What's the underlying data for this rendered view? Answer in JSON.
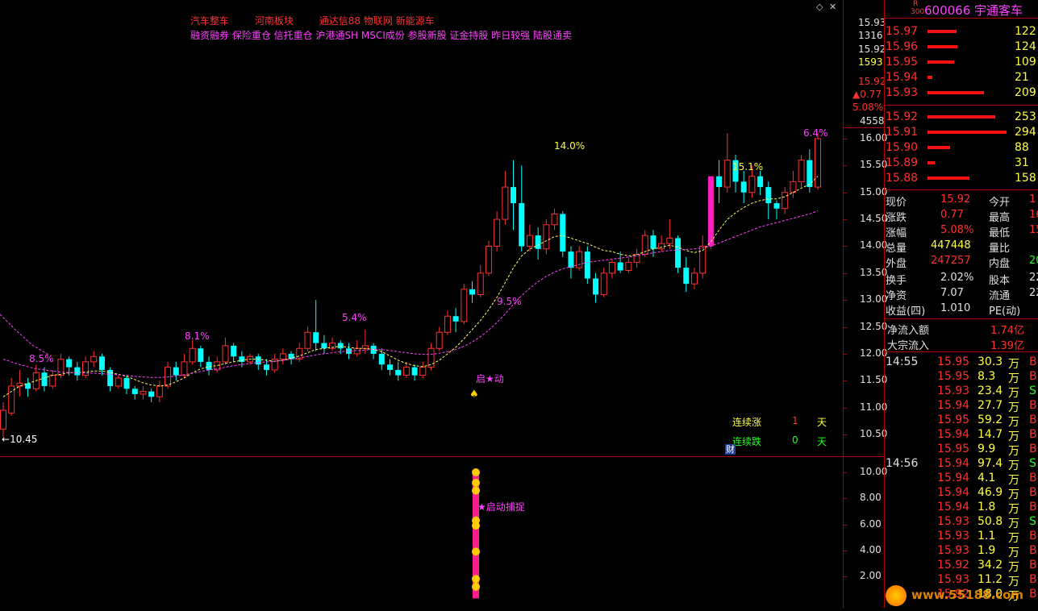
{
  "header": {
    "tags_line1": [
      "汽车整车",
      "河南板块",
      "通达信88 物联网 新能源车"
    ],
    "tags_line2": "融资融券 保险重仓 信托重仓 沪港通SH MSCI成份 参股新股 证金持股 昨日较强 陆股通卖"
  },
  "stock": {
    "badge_top": "R",
    "badge_bottom": "300",
    "code_name": "600066 宇通客车"
  },
  "main_axis": {
    "labels": [
      "16.00",
      "15.50",
      "15.00",
      "14.50",
      "14.00",
      "13.50",
      "13.00",
      "12.50",
      "12.00",
      "11.50",
      "11.00",
      "10.50"
    ],
    "top_info": [
      "15.93",
      "1316",
      "15.92",
      "1593",
      "15.92",
      "▲0.77",
      "5.08%",
      "4558"
    ]
  },
  "sub_axis": {
    "labels": [
      "10.00",
      "8.00",
      "6.00",
      "4.00",
      "2.00"
    ]
  },
  "chart_annotations": {
    "pct_labels": [
      "8.5%",
      "8.1%",
      "5.4%",
      "9.5%",
      "14.0%",
      "15.1%",
      "6.4%"
    ],
    "low_label": "10.45",
    "start_label": "启★动",
    "start_capture": "启动捕捉",
    "consec_up_label": "连续涨",
    "consec_up_count": "1",
    "consec_down_label": "连续跌",
    "consec_down_count": "0",
    "day_unit": "天",
    "cai_badge": "财"
  },
  "chart_data": {
    "type": "candlestick",
    "ylim": [
      10.2,
      16.3
    ],
    "candles": [
      [
        10.6,
        10.95,
        10.45,
        11.1
      ],
      [
        10.9,
        11.4,
        10.85,
        11.55
      ],
      [
        11.4,
        11.45,
        11.2,
        11.7
      ],
      [
        11.45,
        11.35,
        11.2,
        11.55
      ],
      [
        11.35,
        11.65,
        11.3,
        11.8
      ],
      [
        11.65,
        11.4,
        11.3,
        11.75
      ],
      [
        11.4,
        11.6,
        11.35,
        11.7
      ],
      [
        11.6,
        11.9,
        11.55,
        12.0
      ],
      [
        11.9,
        11.75,
        11.6,
        11.95
      ],
      [
        11.75,
        11.6,
        11.5,
        11.85
      ],
      [
        11.6,
        11.85,
        11.55,
        11.95
      ],
      [
        11.85,
        11.95,
        11.75,
        12.05
      ],
      [
        11.95,
        11.7,
        11.6,
        12.0
      ],
      [
        11.7,
        11.4,
        11.3,
        11.75
      ],
      [
        11.4,
        11.55,
        11.35,
        11.6
      ],
      [
        11.55,
        11.35,
        11.25,
        11.6
      ],
      [
        11.35,
        11.25,
        11.15,
        11.4
      ],
      [
        11.25,
        11.3,
        11.15,
        11.4
      ],
      [
        11.3,
        11.2,
        11.1,
        11.35
      ],
      [
        11.2,
        11.4,
        11.1,
        11.5
      ],
      [
        11.4,
        11.75,
        11.35,
        11.85
      ],
      [
        11.75,
        11.6,
        11.5,
        11.85
      ],
      [
        11.6,
        11.85,
        11.55,
        12.0
      ],
      [
        11.85,
        12.1,
        11.8,
        12.25
      ],
      [
        12.1,
        11.85,
        11.75,
        12.15
      ],
      [
        11.85,
        11.7,
        11.6,
        11.95
      ],
      [
        11.7,
        11.85,
        11.65,
        11.95
      ],
      [
        11.85,
        12.15,
        11.8,
        12.3
      ],
      [
        12.15,
        11.95,
        11.85,
        12.2
      ],
      [
        11.95,
        11.85,
        11.75,
        12.05
      ],
      [
        11.85,
        11.95,
        11.8,
        12.0
      ],
      [
        11.95,
        11.8,
        11.7,
        12.0
      ],
      [
        11.8,
        11.7,
        11.6,
        11.9
      ],
      [
        11.7,
        11.9,
        11.65,
        12.0
      ],
      [
        11.9,
        12.0,
        11.8,
        12.1
      ],
      [
        12.0,
        11.9,
        11.8,
        12.05
      ],
      [
        11.9,
        12.1,
        11.85,
        12.2
      ],
      [
        12.1,
        12.4,
        12.05,
        12.5
      ],
      [
        12.4,
        12.2,
        12.05,
        13.0
      ],
      [
        12.2,
        12.1,
        12.0,
        12.35
      ],
      [
        12.1,
        12.2,
        12.05,
        12.3
      ],
      [
        12.2,
        12.1,
        12.0,
        12.25
      ],
      [
        12.1,
        12.0,
        11.9,
        12.2
      ],
      [
        12.0,
        12.1,
        11.95,
        12.25
      ],
      [
        12.1,
        12.15,
        12.0,
        12.45
      ],
      [
        12.15,
        12.0,
        11.9,
        12.2
      ],
      [
        12.0,
        11.8,
        11.7,
        12.1
      ],
      [
        11.8,
        11.7,
        11.6,
        11.9
      ],
      [
        11.7,
        11.6,
        11.5,
        11.85
      ],
      [
        11.6,
        11.75,
        11.55,
        11.85
      ],
      [
        11.75,
        11.6,
        11.5,
        11.8
      ],
      [
        11.6,
        11.75,
        11.55,
        11.85
      ],
      [
        11.75,
        12.1,
        11.7,
        12.2
      ],
      [
        12.1,
        12.4,
        12.05,
        12.5
      ],
      [
        12.4,
        12.7,
        12.35,
        12.8
      ],
      [
        12.7,
        12.6,
        12.4,
        12.85
      ],
      [
        12.6,
        13.2,
        12.55,
        13.3
      ],
      [
        13.2,
        13.1,
        12.95,
        13.35
      ],
      [
        13.1,
        13.5,
        13.05,
        13.65
      ],
      [
        13.5,
        14.0,
        13.45,
        14.1
      ],
      [
        14.0,
        14.5,
        13.9,
        14.65
      ],
      [
        14.5,
        15.1,
        14.4,
        15.4
      ],
      [
        15.1,
        14.8,
        14.3,
        15.6
      ],
      [
        14.8,
        14.0,
        13.9,
        15.5
      ],
      [
        14.0,
        14.2,
        13.9,
        14.4
      ],
      [
        14.2,
        13.95,
        13.75,
        14.35
      ],
      [
        13.95,
        14.4,
        13.85,
        14.5
      ],
      [
        14.4,
        14.6,
        14.3,
        14.7
      ],
      [
        14.6,
        13.9,
        13.8,
        14.65
      ],
      [
        13.9,
        13.6,
        13.4,
        14.0
      ],
      [
        13.6,
        13.9,
        13.55,
        14.0
      ],
      [
        13.9,
        13.4,
        13.3,
        14.0
      ],
      [
        13.4,
        13.1,
        12.95,
        13.5
      ],
      [
        13.1,
        13.5,
        13.05,
        13.6
      ],
      [
        13.5,
        13.7,
        13.4,
        13.75
      ],
      [
        13.7,
        13.55,
        13.5,
        13.9
      ],
      [
        13.55,
        13.7,
        13.5,
        13.8
      ],
      [
        13.7,
        13.85,
        13.6,
        13.95
      ],
      [
        13.85,
        14.2,
        13.8,
        14.3
      ],
      [
        14.2,
        13.95,
        13.8,
        14.3
      ],
      [
        13.95,
        14.05,
        13.9,
        14.2
      ],
      [
        14.05,
        14.15,
        13.95,
        14.5
      ],
      [
        14.15,
        13.6,
        13.5,
        14.2
      ],
      [
        13.6,
        13.3,
        13.15,
        13.8
      ],
      [
        13.3,
        13.5,
        13.2,
        13.6
      ],
      [
        13.5,
        14.0,
        13.4,
        14.2
      ],
      [
        14.0,
        15.3,
        13.95,
        15.3
      ],
      [
        15.3,
        15.1,
        14.8,
        15.6
      ],
      [
        15.1,
        15.6,
        15.0,
        16.1
      ],
      [
        15.6,
        15.2,
        15.0,
        15.7
      ],
      [
        15.2,
        15.0,
        14.8,
        15.4
      ],
      [
        15.0,
        15.3,
        14.9,
        15.5
      ],
      [
        15.3,
        15.1,
        14.95,
        15.4
      ],
      [
        15.1,
        14.8,
        14.5,
        15.2
      ],
      [
        14.8,
        14.7,
        14.5,
        14.85
      ],
      [
        14.7,
        15.0,
        14.6,
        15.1
      ],
      [
        15.0,
        15.2,
        14.9,
        15.4
      ],
      [
        15.2,
        15.6,
        15.1,
        15.7
      ],
      [
        15.6,
        15.1,
        15.0,
        15.8
      ],
      [
        15.1,
        16.0,
        15.05,
        16.1
      ]
    ],
    "ma1": [
      11.2,
      11.3,
      11.4,
      11.45,
      11.5,
      11.55,
      11.6,
      11.62,
      11.65,
      11.65,
      11.66,
      11.68,
      11.68,
      11.65,
      11.62,
      11.58,
      11.52,
      11.46,
      11.42,
      11.4,
      11.42,
      11.48,
      11.55,
      11.65,
      11.72,
      11.76,
      11.78,
      11.82,
      11.85,
      11.88,
      11.9,
      11.9,
      11.88,
      11.86,
      11.88,
      11.92,
      11.96,
      12.02,
      12.08,
      12.1,
      12.12,
      12.14,
      12.12,
      12.1,
      12.1,
      12.08,
      12.04,
      11.96,
      11.88,
      11.82,
      11.78,
      11.76,
      11.8,
      11.88,
      12.0,
      12.12,
      12.28,
      12.45,
      12.62,
      12.82,
      13.05,
      13.32,
      13.6,
      13.82,
      13.95,
      14.02,
      14.1,
      14.18,
      14.2,
      14.15,
      14.1,
      14.05,
      13.98,
      13.92,
      13.9,
      13.85,
      13.82,
      13.84,
      13.9,
      13.95,
      13.98,
      14.02,
      13.98,
      13.92,
      13.88,
      13.92,
      14.08,
      14.3,
      14.5,
      14.62,
      14.72,
      14.8,
      14.85,
      14.88,
      14.88,
      14.92,
      15.0,
      15.08,
      15.15,
      15.3
    ],
    "ma2": [
      11.9,
      11.85,
      11.8,
      11.76,
      11.72,
      11.7,
      11.68,
      11.66,
      11.65,
      11.65,
      11.64,
      11.64,
      11.63,
      11.62,
      11.61,
      11.6,
      11.58,
      11.57,
      11.56,
      11.56,
      11.57,
      11.59,
      11.61,
      11.64,
      11.67,
      11.7,
      11.72,
      11.75,
      11.78,
      11.8,
      11.82,
      11.84,
      11.85,
      11.86,
      11.88,
      11.9,
      11.92,
      11.95,
      11.98,
      12.0,
      12.02,
      12.04,
      12.05,
      12.06,
      12.07,
      12.08,
      12.08,
      12.06,
      12.04,
      12.02,
      12.0,
      11.99,
      11.99,
      12.01,
      12.04,
      12.08,
      12.14,
      12.22,
      12.32,
      12.44,
      12.58,
      12.74,
      12.92,
      13.08,
      13.22,
      13.34,
      13.44,
      13.52,
      13.58,
      13.62,
      13.66,
      13.7,
      13.72,
      13.74,
      13.76,
      13.78,
      13.8,
      13.82,
      13.85,
      13.88,
      13.9,
      13.92,
      13.93,
      13.94,
      13.95,
      13.97,
      14.0,
      14.06,
      14.12,
      14.18,
      14.24,
      14.3,
      14.36,
      14.4,
      14.44,
      14.48,
      14.52,
      14.56,
      14.6,
      14.66
    ]
  },
  "order_book": {
    "asks": [
      {
        "price": "15.97",
        "vol": "122",
        "bar": 0.36
      },
      {
        "price": "15.96",
        "vol": "124",
        "bar": 0.37
      },
      {
        "price": "15.95",
        "vol": "109",
        "bar": 0.33
      },
      {
        "price": "15.94",
        "vol": "21",
        "bar": 0.06
      },
      {
        "price": "15.93",
        "vol": "209",
        "bar": 0.7
      }
    ],
    "bids": [
      {
        "price": "15.92",
        "vol": "253",
        "bar": 0.84
      },
      {
        "price": "15.91",
        "vol": "294",
        "bar": 0.98
      },
      {
        "price": "15.90",
        "vol": "88",
        "bar": 0.28
      },
      {
        "price": "15.89",
        "vol": "31",
        "bar": 0.09
      },
      {
        "price": "15.88",
        "vol": "158",
        "bar": 0.52
      }
    ]
  },
  "stats": [
    {
      "l1": "现价",
      "v1": "15.92",
      "l2": "今开",
      "v2": "1"
    },
    {
      "l1": "涨跌",
      "v1": "0.77",
      "l2": "最高",
      "v2": "16"
    },
    {
      "l1": "涨幅",
      "v1": "5.08%",
      "l2": "最低",
      "v2": "15"
    },
    {
      "l1": "总量",
      "v1": "447448",
      "l2": "量比",
      "v2": ""
    },
    {
      "l1": "外盘",
      "v1": "247257",
      "l2": "内盘",
      "v2": "200"
    },
    {
      "l1": "换手",
      "v1": "2.02%",
      "l2": "股本",
      "v2": "22"
    },
    {
      "l1": "净资",
      "v1": "7.07",
      "l2": "流通",
      "v2": "22"
    },
    {
      "l1": "收益(四)",
      "v1": "1.010",
      "l2": "PE(动)",
      "v2": ""
    }
  ],
  "flows": [
    {
      "label": "净流入额",
      "value": "1.74亿"
    },
    {
      "label": "大宗流入",
      "value": "1.39亿"
    }
  ],
  "ticks": [
    {
      "time": "14:55",
      "price": "15.95",
      "vol": "30.3",
      "unit": "万",
      "side": "B"
    },
    {
      "time": "",
      "price": "15.95",
      "vol": "8.3",
      "unit": "万",
      "side": "B"
    },
    {
      "time": "",
      "price": "15.93",
      "vol": "23.4",
      "unit": "万",
      "side": "S"
    },
    {
      "time": "",
      "price": "15.94",
      "vol": "27.7",
      "unit": "万",
      "side": "B"
    },
    {
      "time": "",
      "price": "15.95",
      "vol": "59.2",
      "unit": "万",
      "side": "B"
    },
    {
      "time": "",
      "price": "15.94",
      "vol": "14.7",
      "unit": "万",
      "side": "B"
    },
    {
      "time": "",
      "price": "15.95",
      "vol": "9.9",
      "unit": "万",
      "side": "B"
    },
    {
      "time": "14:56",
      "price": "15.94",
      "vol": "97.4",
      "unit": "万",
      "side": "S"
    },
    {
      "time": "",
      "price": "15.94",
      "vol": "4.1",
      "unit": "万",
      "side": "B"
    },
    {
      "time": "",
      "price": "15.94",
      "vol": "46.9",
      "unit": "万",
      "side": "B"
    },
    {
      "time": "",
      "price": "15.94",
      "vol": "1.8",
      "unit": "万",
      "side": "B"
    },
    {
      "time": "",
      "price": "15.93",
      "vol": "50.8",
      "unit": "万",
      "side": "S"
    },
    {
      "time": "",
      "price": "15.93",
      "vol": "1.1",
      "unit": "万",
      "side": "B"
    },
    {
      "time": "",
      "price": "15.93",
      "vol": "1.9",
      "unit": "万",
      "side": "B"
    },
    {
      "time": "",
      "price": "15.92",
      "vol": "34.2",
      "unit": "万",
      "side": "B"
    },
    {
      "time": "",
      "price": "15.93",
      "vol": "11.2",
      "unit": "万",
      "side": "B"
    },
    {
      "time": "",
      "price": "15.92",
      "vol": "18.0",
      "unit": "万",
      "side": "B"
    }
  ],
  "watermark": "www.55188.com",
  "colors": {
    "up": "#ff3030",
    "down": "#00ffff",
    "ma1": "#ffff60",
    "ma2": "#ff40ff",
    "grid": "#b00000"
  }
}
